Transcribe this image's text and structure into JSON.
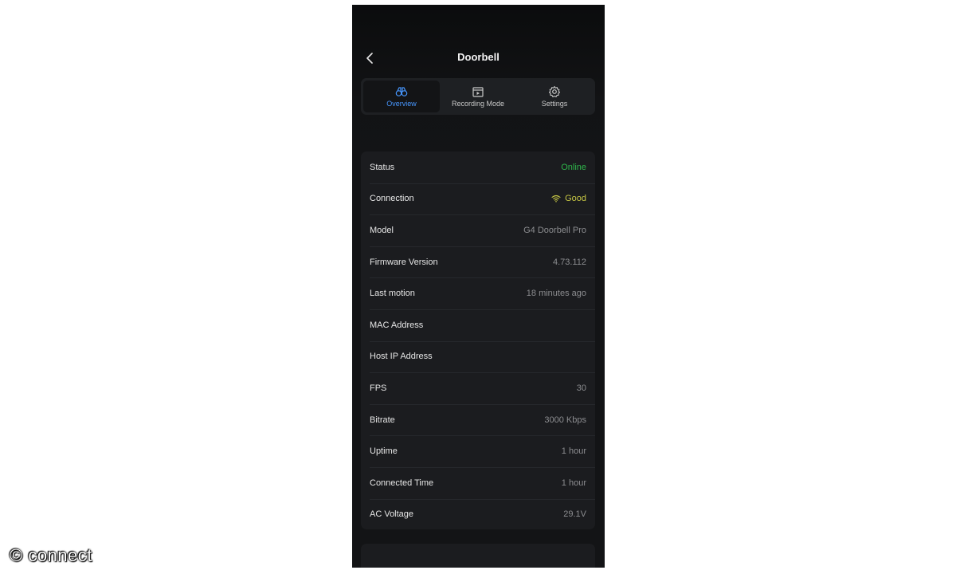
{
  "header": {
    "title": "Doorbell"
  },
  "tabs": [
    {
      "label": "Overview",
      "icon": "binoculars-icon",
      "active": true
    },
    {
      "label": "Recording Mode",
      "icon": "recording-icon",
      "active": false
    },
    {
      "label": "Settings",
      "icon": "gear-icon",
      "active": false
    }
  ],
  "details": [
    {
      "label": "Status",
      "value": "Online"
    },
    {
      "label": "Connection",
      "value": "Good"
    },
    {
      "label": "Model",
      "value": "G4 Doorbell Pro"
    },
    {
      "label": "Firmware Version",
      "value": "4.73.112"
    },
    {
      "label": "Last motion",
      "value": "18 minutes ago"
    },
    {
      "label": "MAC Address",
      "value": ""
    },
    {
      "label": "Host IP Address",
      "value": ""
    },
    {
      "label": "FPS",
      "value": "30"
    },
    {
      "label": "Bitrate",
      "value": "3000 Kbps"
    },
    {
      "label": "Uptime",
      "value": "1 hour"
    },
    {
      "label": "Connected Time",
      "value": "1 hour"
    },
    {
      "label": "AC Voltage",
      "value": "29.1V"
    }
  ],
  "colors": {
    "accent": "#4797ff",
    "online": "#2fb64b",
    "good": "#c6c644",
    "background": "#131416",
    "card": "#1b1c1f"
  },
  "watermark": "© connect"
}
